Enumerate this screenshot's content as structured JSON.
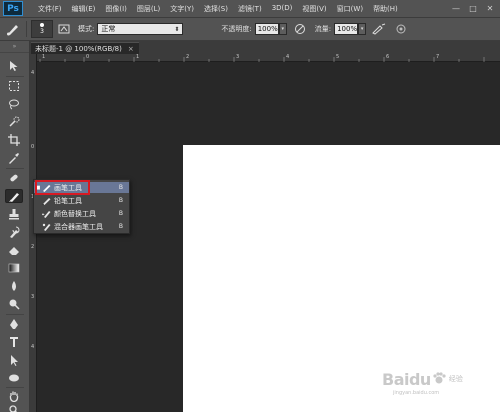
{
  "app": {
    "logo": "Ps"
  },
  "menu": [
    "文件(F)",
    "编辑(E)",
    "图像(I)",
    "图层(L)",
    "文字(Y)",
    "选择(S)",
    "滤镜(T)",
    "3D(D)",
    "视图(V)",
    "窗口(W)",
    "帮助(H)"
  ],
  "window_controls": [
    "—",
    "□",
    "✕"
  ],
  "options_bar": {
    "brush_size": "3",
    "mode_label": "模式:",
    "mode_value": "正常",
    "opacity_label": "不透明度:",
    "opacity_value": "100%",
    "flow_label": "流量:",
    "flow_value": "100%"
  },
  "document_tab": {
    "title": "未标题-1 @ 100%(RGB/8)",
    "close": "×"
  },
  "ruler": {
    "top_labels": [
      "1",
      "0",
      "1",
      "2",
      "3",
      "4",
      "5",
      "6",
      "7"
    ],
    "left_labels": [
      "4",
      "0",
      "1",
      "2",
      "3",
      "4"
    ]
  },
  "flyout": [
    {
      "label": "画笔工具",
      "key": "B",
      "selected": true
    },
    {
      "label": "铅笔工具",
      "key": "B",
      "selected": false
    },
    {
      "label": "颜色替换工具",
      "key": "B",
      "selected": false
    },
    {
      "label": "混合器画笔工具",
      "key": "B",
      "selected": false
    }
  ],
  "watermark": {
    "brand": "Baidu",
    "sub": "经验",
    "url": "jingyan.baidu.com"
  },
  "colors": {
    "panel": "#535353",
    "canvas_bg": "#282828",
    "flyout_selected": "#697796",
    "highlight": "#d81a23"
  }
}
